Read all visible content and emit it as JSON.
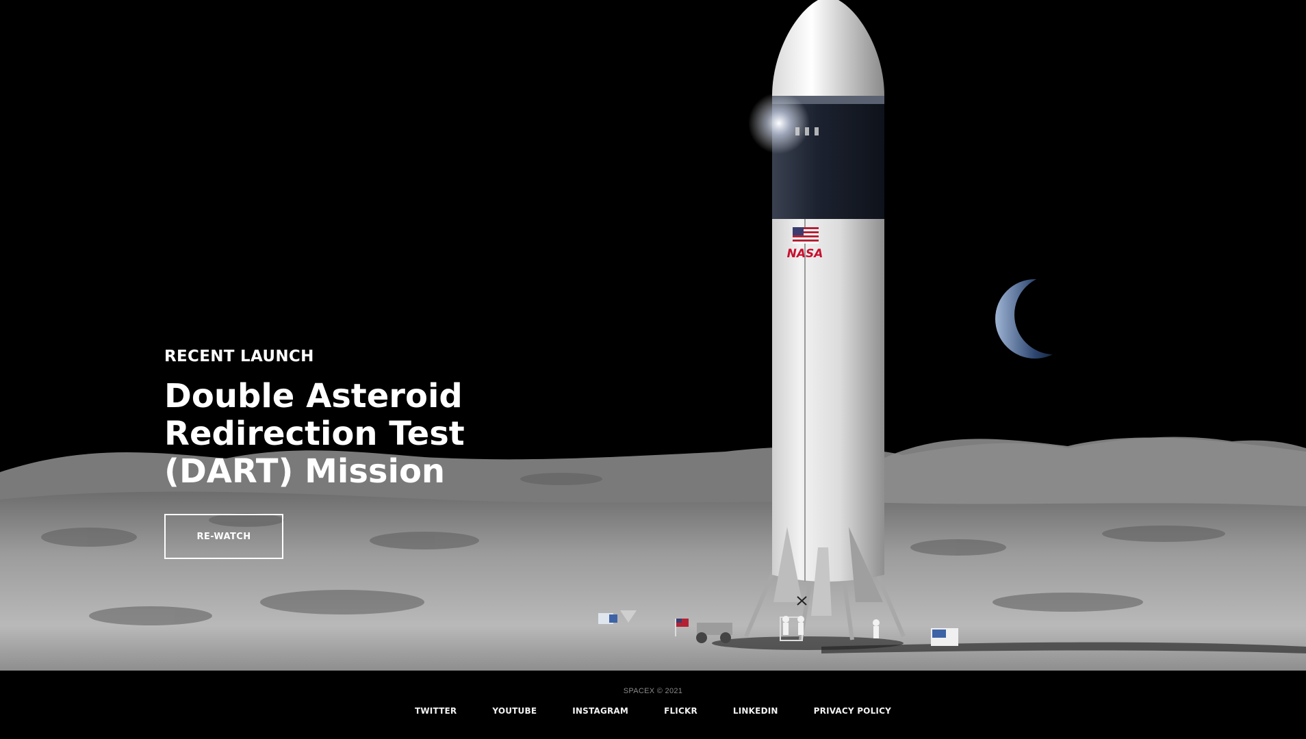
{
  "hero": {
    "eyebrow": "RECENT LAUNCH",
    "headline": "Double Asteroid Redirection Test (DART) Mission",
    "cta_label": "RE-WATCH",
    "rocket_agency_mark": "NASA"
  },
  "footer": {
    "copyright": "SPACEX © 2021",
    "links": [
      {
        "label": "TWITTER"
      },
      {
        "label": "YOUTUBE"
      },
      {
        "label": "INSTAGRAM"
      },
      {
        "label": "FLICKR"
      },
      {
        "label": "LINKEDIN"
      },
      {
        "label": "PRIVACY POLICY"
      }
    ]
  },
  "colors": {
    "background": "#000000",
    "text": "#ffffff",
    "footer_muted": "#8a8a8a",
    "lunar_surface": "#9a9a9a",
    "rocket_body": "#e6e6e6",
    "nasa_red": "#c8102e"
  }
}
